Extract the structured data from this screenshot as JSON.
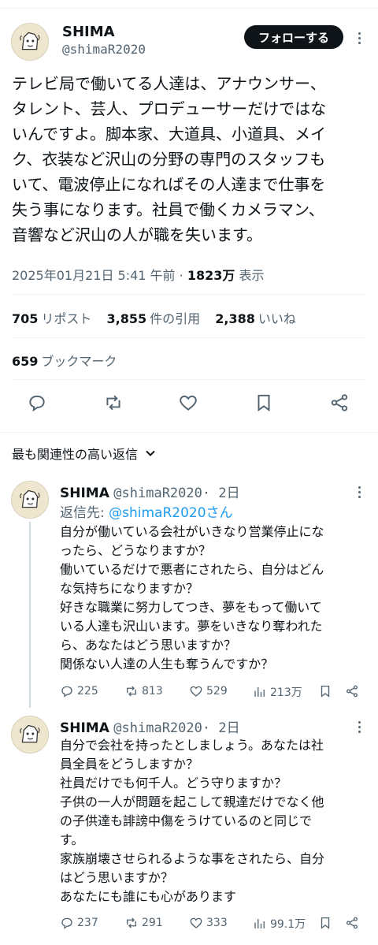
{
  "tweet": {
    "author_name": "SHIMA",
    "author_handle": "@shimaR2020",
    "follow_label": "フォローする",
    "text": "テレビ局で働いてる人達は、アナウンサー、\nタレント、芸人、プロデューサーだけではな\nいんですよ。脚本家、大道具、小道具、メイ\nク、衣装など沢山の分野の専門のスタッフも\nいて、電波停止になればその人達まで仕事を\n失う事になります。社員で働くカメラマン、\n音響など沢山の人が職を失います。",
    "timestamp": "2025年01月21日 5:41 午前 · ",
    "views_count": "1823万",
    "views_label": " 表示",
    "reposts_count": "705",
    "reposts_label": "リポスト",
    "quotes_count": "3,855",
    "quotes_label": "件の引用",
    "likes_count": "2,388",
    "likes_label": "いいね",
    "bookmarks_count": "659",
    "bookmarks_label": "ブックマーク"
  },
  "relevance_label": "最も関連性の高い返信",
  "replies": [
    {
      "author_name": "SHIMA",
      "author_handle": "@shimaR2020",
      "time": "· 2日",
      "reply_to_prefix": "返信先: ",
      "reply_to_handle": "@shimaR2020さん",
      "text": "自分が働いている会社がいきなり営業停止にな\nったら、どうなりますか？\n働いているだけで悪者にされたら、自分はどん\nな気持ちになりますか？\n好きな職業に努力してつき、夢をもって働いて\nいる人達も沢山います。夢をいきなり奪われた\nら、あなたはどう思いますか？\n関係ない人達の人生も奪うんですか？",
      "replies": "225",
      "reposts": "813",
      "likes": "529",
      "views": "213万"
    },
    {
      "author_name": "SHIMA",
      "author_handle": "@shimaR2020",
      "time": "· 2日",
      "text": "自分で会社を持ったとしましょう。あなたは社\n員全員をどうしますか？\n社員だけでも何千人。どう守りますか？\n子供の一人が問題を起こして親達だけでなく他\nの子供達も誹謗中傷をうけているのと同じで\nす。\n家族崩壊させられるような事をされたら、自分\nはどう思いますか？\nあなたにも誰にも心があります",
      "replies": "237",
      "reposts": "291",
      "likes": "333",
      "views": "99.1万"
    }
  ],
  "icons": {
    "reply": "reply-icon",
    "repost": "repost-icon",
    "like": "heart-icon",
    "bookmark": "bookmark-icon",
    "share": "share-icon",
    "views": "views-icon",
    "more": "more-icon",
    "chevron": "chevron-down-icon"
  }
}
